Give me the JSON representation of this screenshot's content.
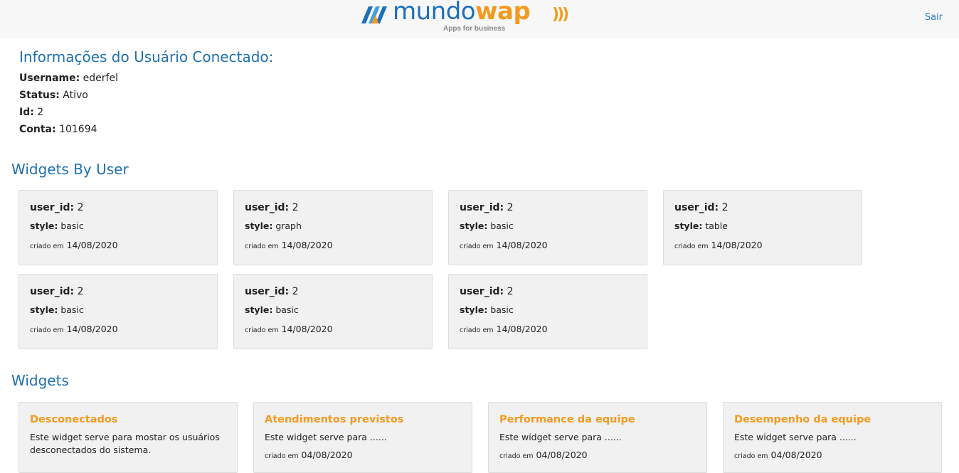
{
  "header": {
    "logo_text_mundo": "mundo",
    "logo_text_wap": "wap",
    "logo_tagline": "Apps for business",
    "logout_label": "Sair"
  },
  "user_info": {
    "title": "Informações do Usuário Conectado:",
    "username_label": "Username:",
    "username": "ederfel",
    "status_label": "Status:",
    "status": "Ativo",
    "id_label": "Id:",
    "id": "2",
    "conta_label": "Conta:",
    "conta": "101694"
  },
  "widgets_by_user": {
    "title": "Widgets By User",
    "user_id_label": "user_id:",
    "style_label": "style:",
    "created_label": "criado em",
    "items": [
      {
        "user_id": "2",
        "style": "basic",
        "created": "14/08/2020"
      },
      {
        "user_id": "2",
        "style": "graph",
        "created": "14/08/2020"
      },
      {
        "user_id": "2",
        "style": "basic",
        "created": "14/08/2020"
      },
      {
        "user_id": "2",
        "style": "table",
        "created": "14/08/2020"
      },
      {
        "user_id": "2",
        "style": "basic",
        "created": "14/08/2020"
      },
      {
        "user_id": "2",
        "style": "basic",
        "created": "14/08/2020"
      },
      {
        "user_id": "2",
        "style": "basic",
        "created": "14/08/2020"
      }
    ]
  },
  "widgets": {
    "title": "Widgets",
    "created_label": "criado em",
    "items": [
      {
        "name": "Desconectados",
        "description": "Este widget serve para mostar os usuários desconectados do sistema.",
        "created": ""
      },
      {
        "name": "Atendimentos previstos",
        "description": "Este widget serve para ......",
        "created": "04/08/2020"
      },
      {
        "name": "Performance da equipe",
        "description": "Este widget serve para ......",
        "created": "04/08/2020"
      },
      {
        "name": "Desempenho da equipe",
        "description": "Este widget serve para ......",
        "created": "04/08/2020"
      }
    ]
  },
  "colors": {
    "brand_blue": "#1d6fb8",
    "brand_orange": "#f39a1e",
    "section_title": "#1f6fae",
    "card_bg": "#f1f1f1"
  }
}
